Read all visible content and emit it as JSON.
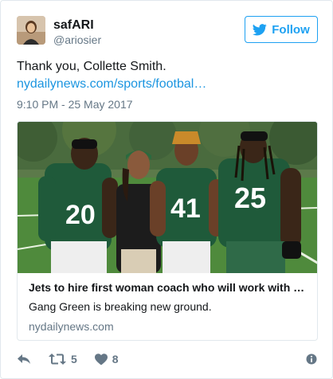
{
  "user": {
    "name": "safARI",
    "handle": "@ariosier",
    "avatar_icon": "profile-photo"
  },
  "follow": {
    "label": "Follow",
    "icon": "twitter-bird-icon",
    "color": "#1da1f2"
  },
  "tweet": {
    "text": "Thank you, Collette Smith.",
    "link": "nydailynews.com/sports/footbal…",
    "timestamp": "9:10 PM - 25 May 2017"
  },
  "card": {
    "title": "Jets to hire first woman coach who will work with …",
    "description": "Gang Green is breaking new ground.",
    "domain": "nydailynews.com",
    "jersey_numbers": [
      "20",
      "41",
      "25"
    ]
  },
  "actions": {
    "reply_icon": "reply-icon",
    "retweet_count": "5",
    "like_count": "8",
    "info_icon": "info-icon"
  },
  "colors": {
    "link": "#1b95e0",
    "muted": "#657786",
    "border": "#e1e8ed",
    "jersey_green": "#1f5a3a"
  }
}
